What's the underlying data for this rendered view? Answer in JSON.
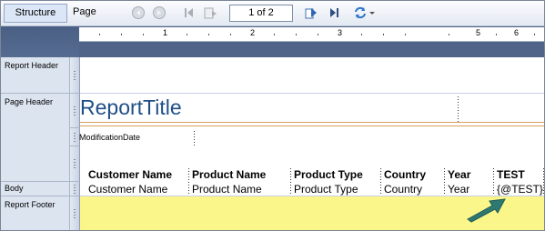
{
  "toolbar": {
    "structure_label": "Structure",
    "page_label": "Page",
    "page_indicator": "1 of 2",
    "icons": [
      "prev-circle-icon",
      "next-circle-icon",
      "first-page-icon",
      "export-page-icon",
      "goto-page-icon",
      "last-page-icon",
      "refresh-icon",
      "dropdown-arrow-icon"
    ]
  },
  "ruler": {
    "marks": [
      "1",
      "2",
      "3",
      "5",
      "6"
    ]
  },
  "sections": {
    "report_header": "Report Header",
    "page_header": "Page Header",
    "body": "Body",
    "report_footer": "Report Footer"
  },
  "page_header": {
    "title": "ReportTitle",
    "modification_date": "ModificationDate"
  },
  "columns": {
    "headers": [
      "Customer Name",
      "Product Name",
      "Product Type",
      "Country",
      "Year",
      "TEST"
    ],
    "fields": [
      "Customer Name",
      "Product Name",
      "Product Type",
      "Country",
      "Year",
      "{@TEST}"
    ]
  },
  "colors": {
    "title": "#1f4f88",
    "footer": "#fbf68a",
    "ruler_band": "#4f6488",
    "arrow": "#2d7a72"
  }
}
